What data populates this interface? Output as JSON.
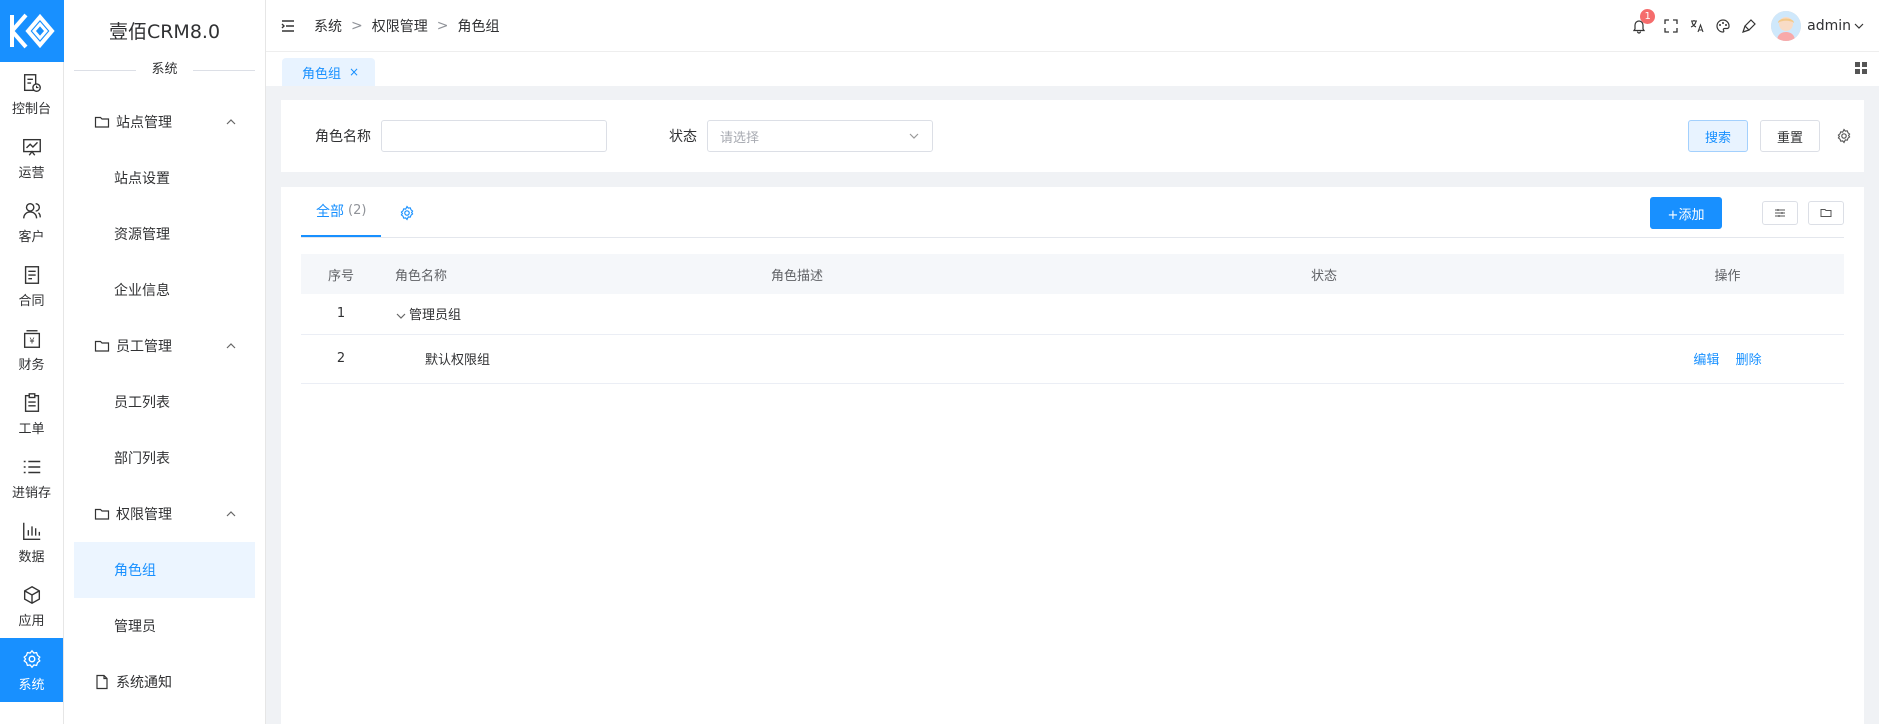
{
  "app": {
    "brand": "壹佰CRM8.0",
    "section_title": "系统"
  },
  "rail": [
    {
      "label": "控制台",
      "icon": "console-icon"
    },
    {
      "label": "运营",
      "icon": "operations-icon"
    },
    {
      "label": "客户",
      "icon": "customer-icon"
    },
    {
      "label": "合同",
      "icon": "contract-icon"
    },
    {
      "label": "财务",
      "icon": "finance-icon"
    },
    {
      "label": "工单",
      "icon": "ticket-icon"
    },
    {
      "label": "进销存",
      "icon": "inventory-icon"
    },
    {
      "label": "数据",
      "icon": "data-chart-icon"
    },
    {
      "label": "应用",
      "icon": "app-cube-icon"
    },
    {
      "label": "系统",
      "icon": "system-gear-icon",
      "active": true
    }
  ],
  "sidebar": {
    "groups": [
      {
        "label": "站点管理",
        "items": [
          "站点设置",
          "资源管理",
          "企业信息"
        ]
      },
      {
        "label": "员工管理",
        "items": [
          "员工列表",
          "部门列表"
        ]
      },
      {
        "label": "权限管理",
        "items": [
          "角色组",
          "管理员"
        ],
        "active_item": "角色组"
      }
    ],
    "extra": {
      "label": "系统通知"
    }
  },
  "header": {
    "breadcrumb": [
      "系统",
      "权限管理",
      "角色组"
    ],
    "separator": ">",
    "notification_count": "1",
    "username": "admin"
  },
  "tabs": {
    "active": "角色组",
    "close": "×"
  },
  "search": {
    "role_name_label": "角色名称",
    "role_name_value": "",
    "status_label": "状态",
    "status_placeholder": "请选择",
    "search_button": "搜索",
    "reset_button": "重置"
  },
  "table": {
    "tab_label": "全部",
    "tab_count": "(2)",
    "add_button": "+添加",
    "columns": [
      "序号",
      "角色名称",
      "角色描述",
      "状态",
      "操作"
    ],
    "rows": [
      {
        "no": "1",
        "name": "管理员组",
        "desc": "",
        "status": "",
        "ops": []
      },
      {
        "no": "2",
        "name": "默认权限组",
        "desc": "",
        "status": "",
        "ops": [
          "编辑",
          "删除"
        ]
      }
    ]
  },
  "colors": {
    "primary": "#1890ff",
    "badge": "#f56c6c",
    "active_bg": "#ecf5ff"
  }
}
